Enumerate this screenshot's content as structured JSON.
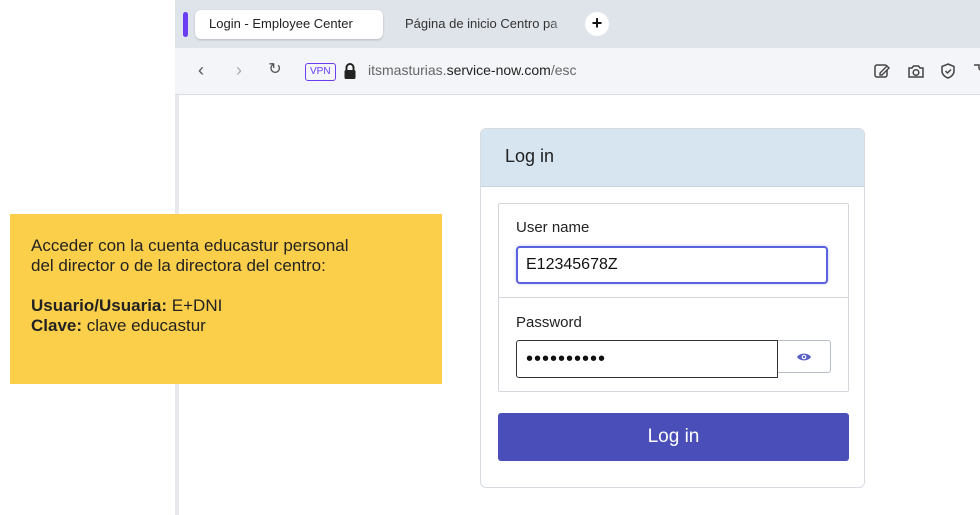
{
  "browser": {
    "tabs": [
      {
        "label": "Login - Employee Center",
        "active": true
      },
      {
        "label": "Página de inicio Centro pa",
        "active": false
      }
    ],
    "new_tab_icon": "plus-icon",
    "vpn_label": "VPN",
    "url_prefix": "itsmasturias.",
    "url_domain": "service-now.com",
    "url_path": "/esc",
    "accent_color": "#6b3df2"
  },
  "login": {
    "header_title": "Log in",
    "username_label": "User name",
    "username_value": "E12345678Z",
    "password_label": "Password",
    "password_mask": "••••••••••",
    "submit_label": "Log in",
    "button_color": "#4a4eb8",
    "header_color": "#d6e5f0"
  },
  "note": {
    "background": "#fccf4b",
    "line1": "Acceder con la cuenta educastur personal",
    "line2": "del director o de la directora del centro:",
    "user_label": "Usuario/Usuaria:",
    "user_value": "E+DNI",
    "key_label": "Clave:",
    "key_value": "clave educastur"
  }
}
